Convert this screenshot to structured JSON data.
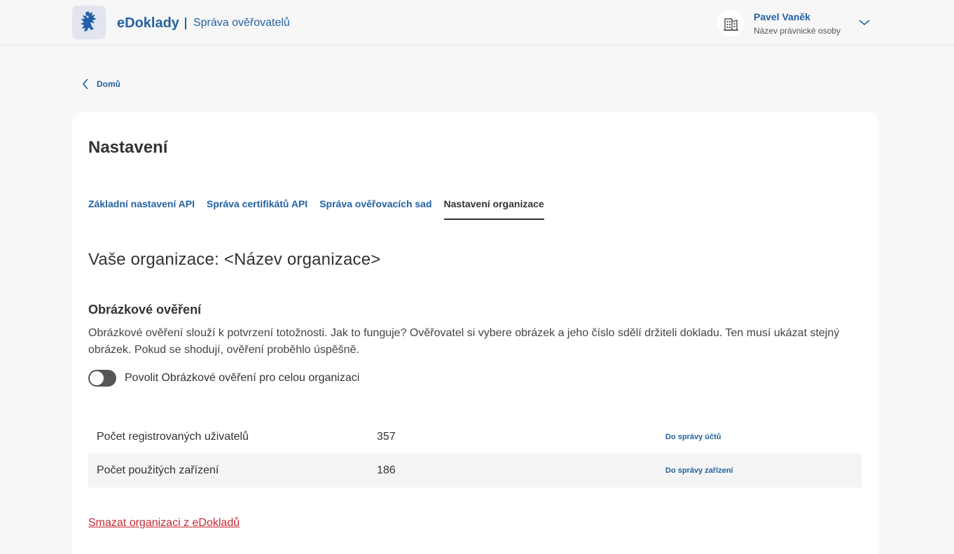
{
  "header": {
    "logo_icon": "lion-emblem-icon",
    "brand_name": "eDoklady",
    "brand_sub": "Správa ověřovatelů",
    "user": {
      "name": "Pavel Vaněk",
      "organization": "Název právnické osoby",
      "icon": "building-icon"
    }
  },
  "breadcrumb": {
    "label": "Domů"
  },
  "page": {
    "title": "Nastavení",
    "tabs": [
      {
        "label": "Základní nastavení API",
        "active": false
      },
      {
        "label": "Správa certifikátů API",
        "active": false
      },
      {
        "label": "Správa ověřovacích sad",
        "active": false
      },
      {
        "label": "Nastavení organizace",
        "active": true
      }
    ],
    "org_heading": "Vaše organizace: <Název organizace>",
    "image_verification": {
      "title": "Obrázkové ověření",
      "description": "Obrázkové ověření slouží k potvrzení totožnosti. Jak to funguje? Ověřovatel si vybere obrázek a jeho číslo sdělí držiteli dokladu. Ten musí ukázat stejný obrázek. Pokud se shodují, ověření proběhlo úspěšně.",
      "toggle_label": "Povolit Obrázkové ověření pro celou organizaci",
      "toggle_on": false
    },
    "stats": [
      {
        "label": "Počet registrovaných uživatelů",
        "value": "357",
        "link": "Do správy účtů"
      },
      {
        "label": "Počet použitých zařízení",
        "value": "186",
        "link": "Do správy zařízení"
      }
    ],
    "delete_link": "Smazat organizaci z eDokladů"
  },
  "colors": {
    "primary": "#2362a2",
    "danger": "#c42a34",
    "background": "#f7f7f7",
    "card": "#ffffff"
  }
}
